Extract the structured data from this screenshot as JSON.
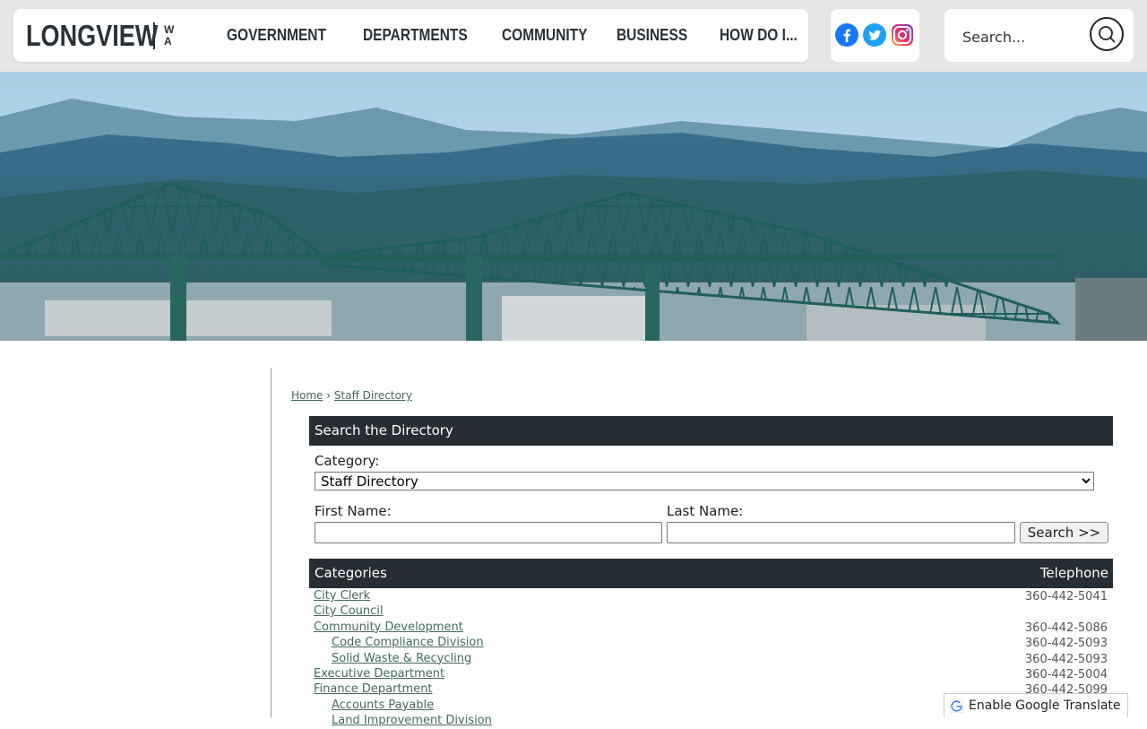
{
  "header": {
    "logo": {
      "word": "LONGVIEW",
      "state_letters": [
        "W",
        "A"
      ]
    },
    "nav": [
      "GOVERNMENT",
      "DEPARTMENTS",
      "COMMUNITY",
      "BUSINESS",
      "HOW DO I..."
    ],
    "social": [
      "facebook-icon",
      "twitter-icon",
      "instagram-icon"
    ],
    "search": {
      "placeholder": "Search..."
    }
  },
  "breadcrumb": {
    "home": "Home",
    "separator": "›",
    "current": "Staff Directory"
  },
  "search_panel": {
    "title": "Search the Directory",
    "category_label": "Category:",
    "category_value": "Staff Directory",
    "first_name_label": "First Name:",
    "last_name_label": "Last Name:",
    "search_button": "Search >>"
  },
  "table": {
    "col_categories": "Categories",
    "col_telephone": "Telephone",
    "rows": [
      {
        "name": "City Clerk",
        "phone": "360-442-5041",
        "indent": false
      },
      {
        "name": "City Council",
        "phone": "",
        "indent": false
      },
      {
        "name": "Community Development",
        "phone": "360-442-5086",
        "indent": false
      },
      {
        "name": "Code Compliance Division",
        "phone": "360-442-5093",
        "indent": true
      },
      {
        "name": "Solid Waste & Recycling",
        "phone": "360-442-5093",
        "indent": true
      },
      {
        "name": "Executive Department",
        "phone": "360-442-5004",
        "indent": false
      },
      {
        "name": "Finance Department",
        "phone": "360-442-5099",
        "indent": false
      },
      {
        "name": "Accounts Payable",
        "phone": "",
        "indent": true
      },
      {
        "name": "Land Improvement Division",
        "phone": "",
        "indent": true
      }
    ]
  },
  "translate": {
    "label": "Enable Google Translate"
  },
  "colors": {
    "header_bg": "#e6e7e4",
    "dark_bar": "#262d33",
    "link": "#446b5d",
    "logo": "#2a3238"
  }
}
